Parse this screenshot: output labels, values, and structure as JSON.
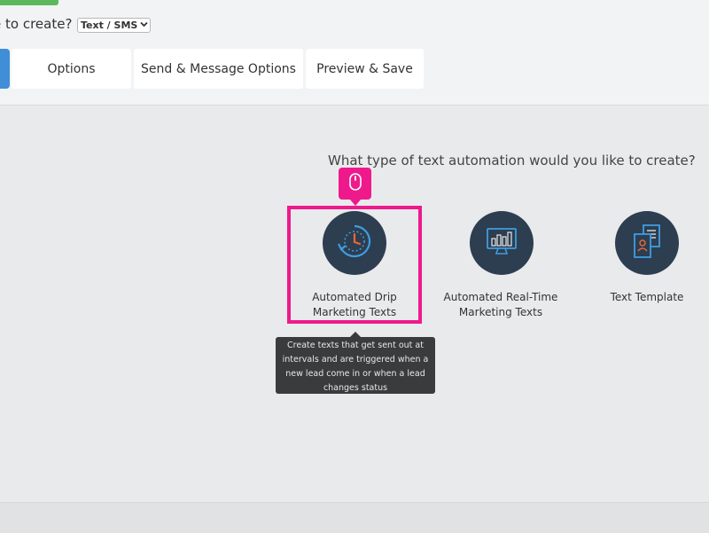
{
  "header": {
    "question": "e to create?",
    "type_select_value": "Text / SMS"
  },
  "tabs": [
    {
      "label": "Options"
    },
    {
      "label": "Send & Message Options"
    },
    {
      "label": "Preview & Save"
    }
  ],
  "main": {
    "question": "What type of text automation would you like to create?",
    "options": [
      {
        "label_line1": "Automated Drip",
        "label_line2": "Marketing Texts",
        "icon": "clock-refresh-icon"
      },
      {
        "label_line1": "Automated Real-Time",
        "label_line2": "Marketing Texts",
        "icon": "monitor-chart-icon"
      },
      {
        "label_line1": "Text Template",
        "label_line2": "",
        "icon": "document-template-icon"
      }
    ],
    "tooltip": "Create texts that get sent out at intervals and are triggered when a new lead come in or when a lead changes status"
  },
  "colors": {
    "highlight": "#ee1a8c",
    "icon_circle": "#2d3e50",
    "icon_accent": "#3f9de0",
    "tab_active": "#3f8ed6",
    "progress": "#5cb85c"
  }
}
